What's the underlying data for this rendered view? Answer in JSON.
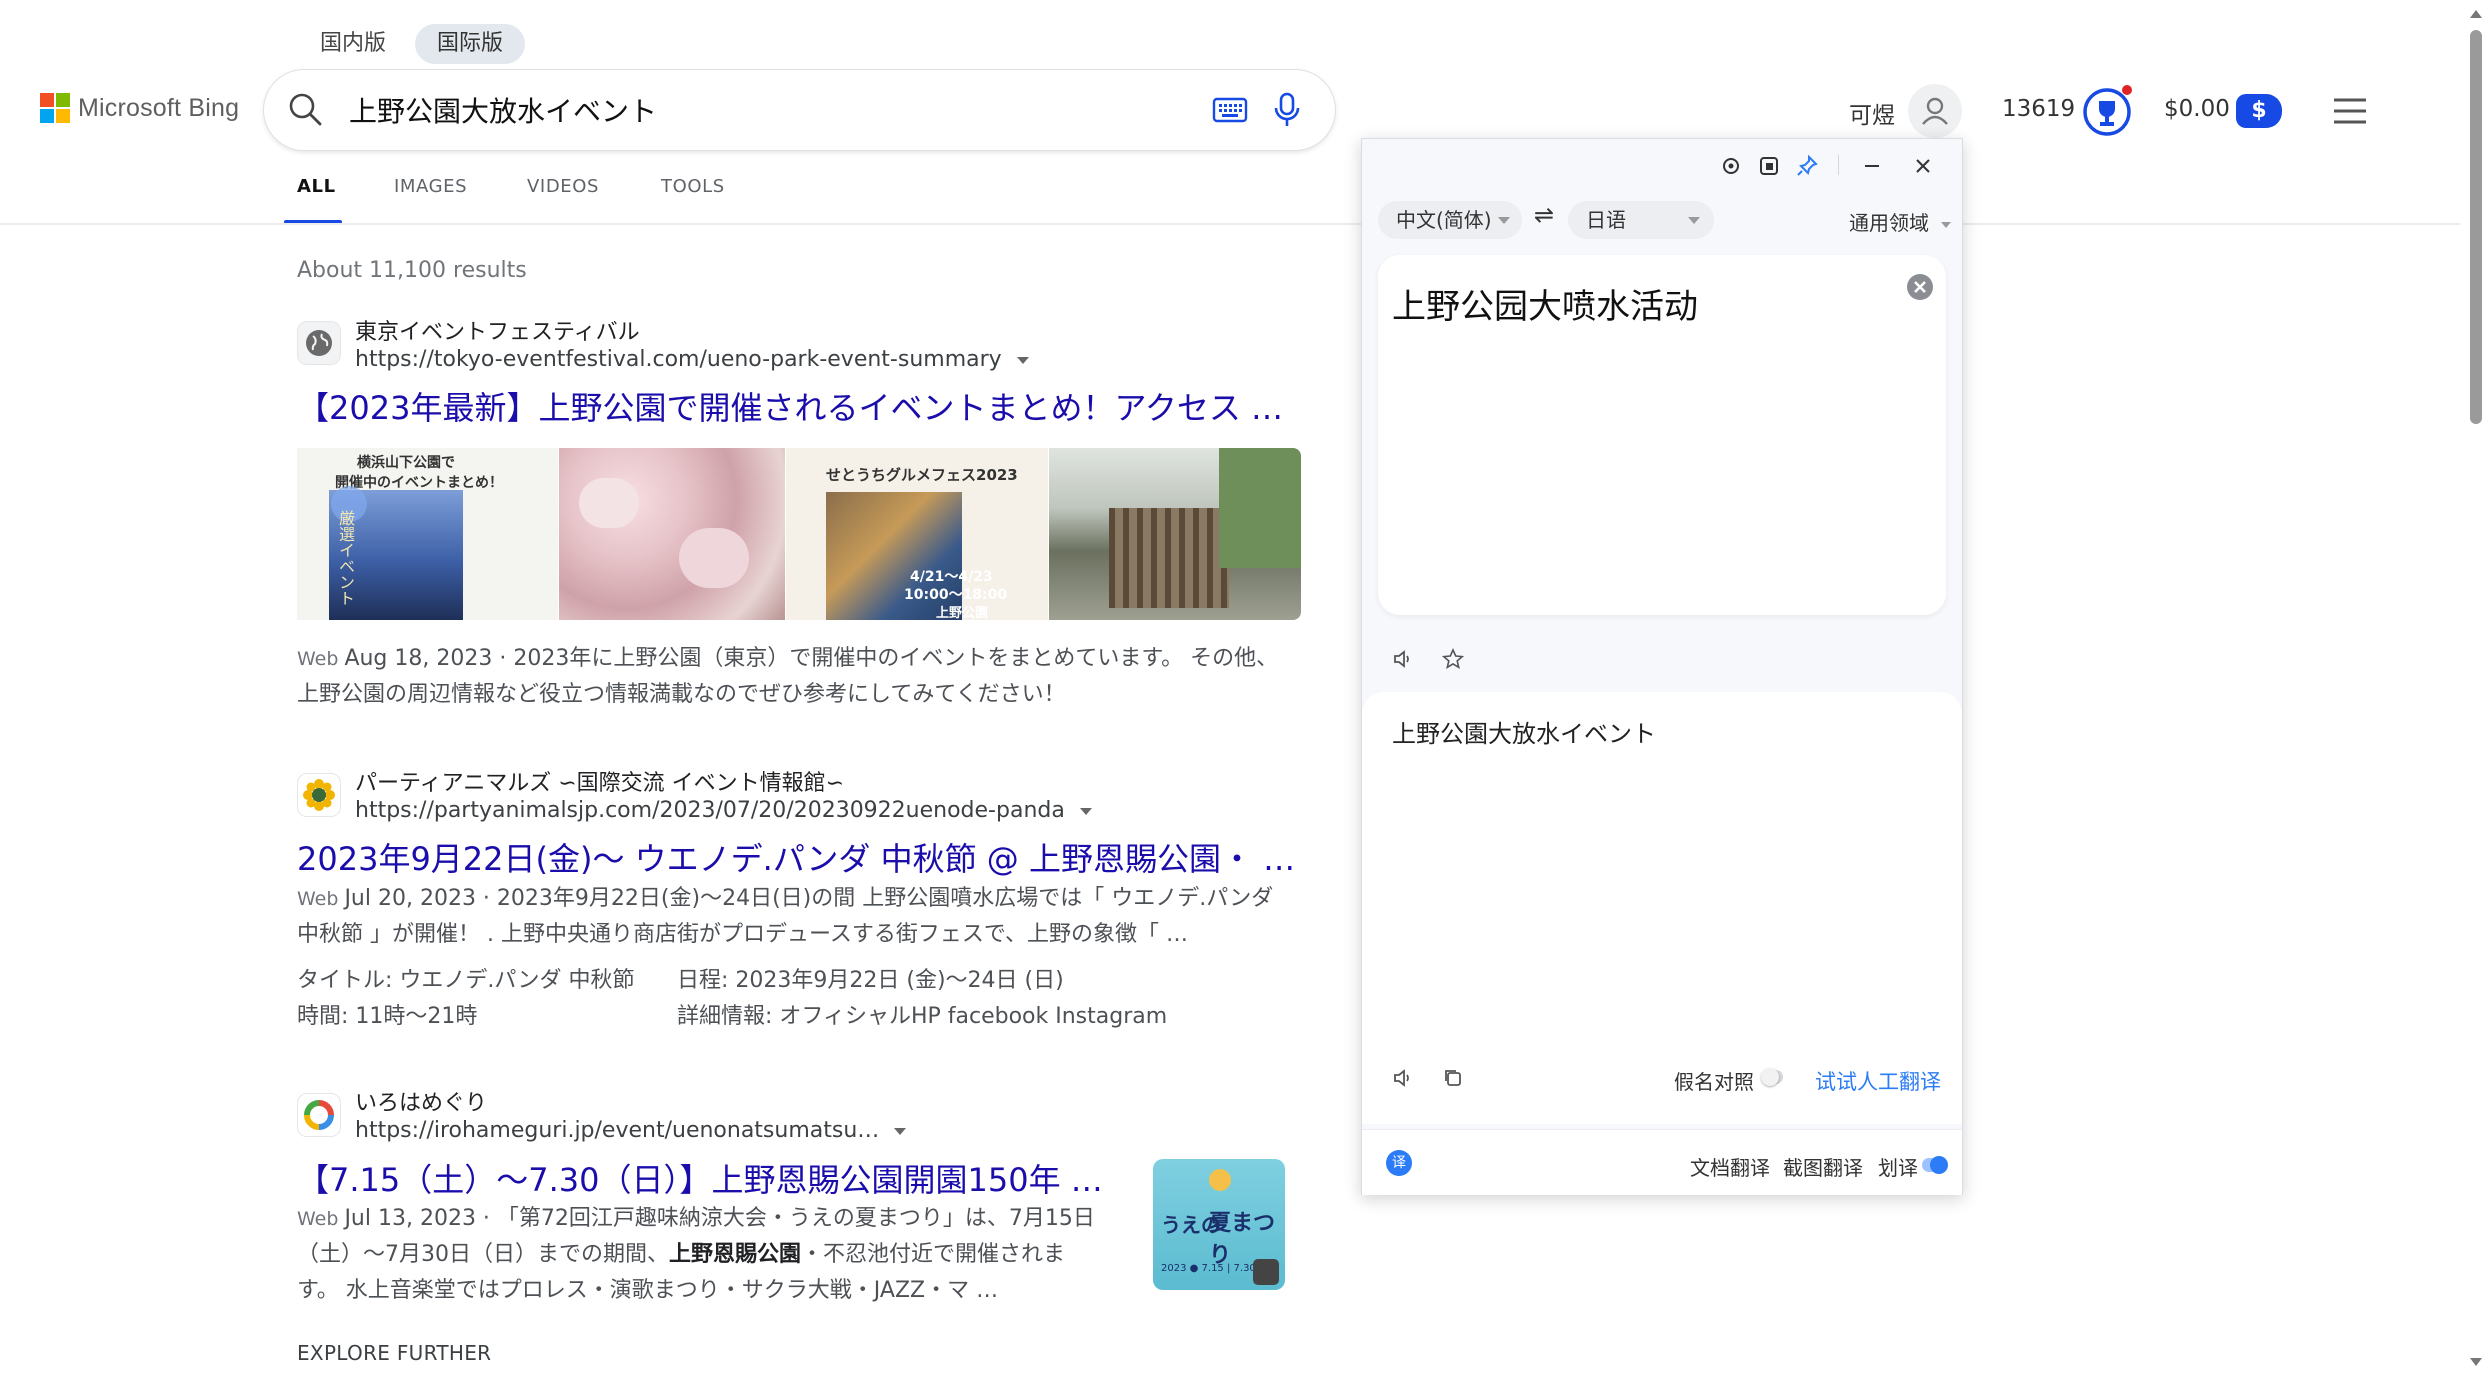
{
  "header": {
    "region_tabs": [
      "国内版",
      "国际版"
    ],
    "logo_text": "Microsoft Bing",
    "search_query": "上野公園大放水イベント",
    "nav_tabs": [
      "ALL",
      "IMAGES",
      "VIDEOS",
      "TOOLS"
    ],
    "user_name": "可煜",
    "points": "13619",
    "balance": "$0.00",
    "balance_icon": "$"
  },
  "results": {
    "count": "About 11,100 results",
    "items": [
      {
        "site": "東京イベントフェスティバル",
        "url": "https://tokyo-eventfestival.com/ueno-park-event-summary",
        "title": "【2023年最新】上野公園で開催されるイベントまとめ！アクセス …",
        "tag": "Web",
        "snippet1": "Aug 18, 2023 · 2023年に上野公園（東京）で開催中のイベントをまとめています。 その他、",
        "snippet2": "上野公園の周辺情報など役立つ情報満載なのでぜひ参考にしてみてください！",
        "thumbs": [
          {
            "text1": "横浜山下公園で",
            "text2": "開催中のイベントまとめ！",
            "text3": "厳選イベント"
          },
          {
            "text1": ""
          },
          {
            "text1": "せとうちグルメフェス2023",
            "text2": "4/21～4/23",
            "text3": "10:00～18:00",
            "text4": "上野公園"
          },
          {
            "text1": ""
          }
        ]
      },
      {
        "site": "パーティアニマルズ ∽国際交流 イベント情報館∽",
        "url": "https://partyanimalsjp.com/2023/07/20/20230922uenode-panda",
        "title": "2023年9月22日(金)～ ウエノデ.パンダ 中秋節 @ 上野恩賜公園・ …",
        "tag": "Web",
        "snippet1": "Jul 20, 2023 · 2023年9月22日(金)～24日(日)の間 上野公園噴水広場では「 ウエノデ.パンダ",
        "snippet2": "中秋節 」が開催！ . 上野中央通り商店街がプロデュースする街フェスで、上野の象徴「 …",
        "fields": [
          "タイトル: ウエノデ.パンダ 中秋節",
          "日程: 2023年9月22日 (金)～24日 (日)",
          "時間: 11時～21時",
          "詳細情報: オフィシャルHP facebook Instagram"
        ]
      },
      {
        "site": "いろはめぐり",
        "url": "https://irohameguri.jp/event/uenonatsumatsu…",
        "title": "【7.15（土）～7.30（日）】上野恩賜公園開園150年 …",
        "tag": "Web",
        "snippet1": "Jul 13, 2023 · 「第72回江戸趣味納涼大会・うえの夏まつり」は、7月15日",
        "snippet2": "（土）～7月30日（日）までの期間、",
        "snippet2_bold": "上野恩賜公園",
        "snippet2_rest": "・不忍池付近で開催されま",
        "snippet3": "す。 水上音楽堂ではプロレス・演歌まつり・サクラ大戦・JAZZ・マ …",
        "thumb_text1": "うえの",
        "thumb_text2": "夏まつり",
        "thumb_text3": "2023 ● 7.15 | 7.30"
      }
    ],
    "explore": "EXPLORE FURTHER"
  },
  "translator": {
    "source_lang": "中文(简体)",
    "swap": "⇌",
    "target_lang": "日语",
    "domain": "通用领域",
    "source_text": "上野公园大喷水活动",
    "result_text": "上野公園大放水イベント",
    "kana_label": "假名对照",
    "human_translate": "试试人工翻译",
    "footer_doc": "文档翻译",
    "footer_screenshot": "截图翻译",
    "footer_select": "划译",
    "logo_char": "译"
  },
  "colors": {
    "link": "#1a0dab",
    "bing_blue": "#174ae4",
    "translator_blue": "#2b7cf6"
  }
}
